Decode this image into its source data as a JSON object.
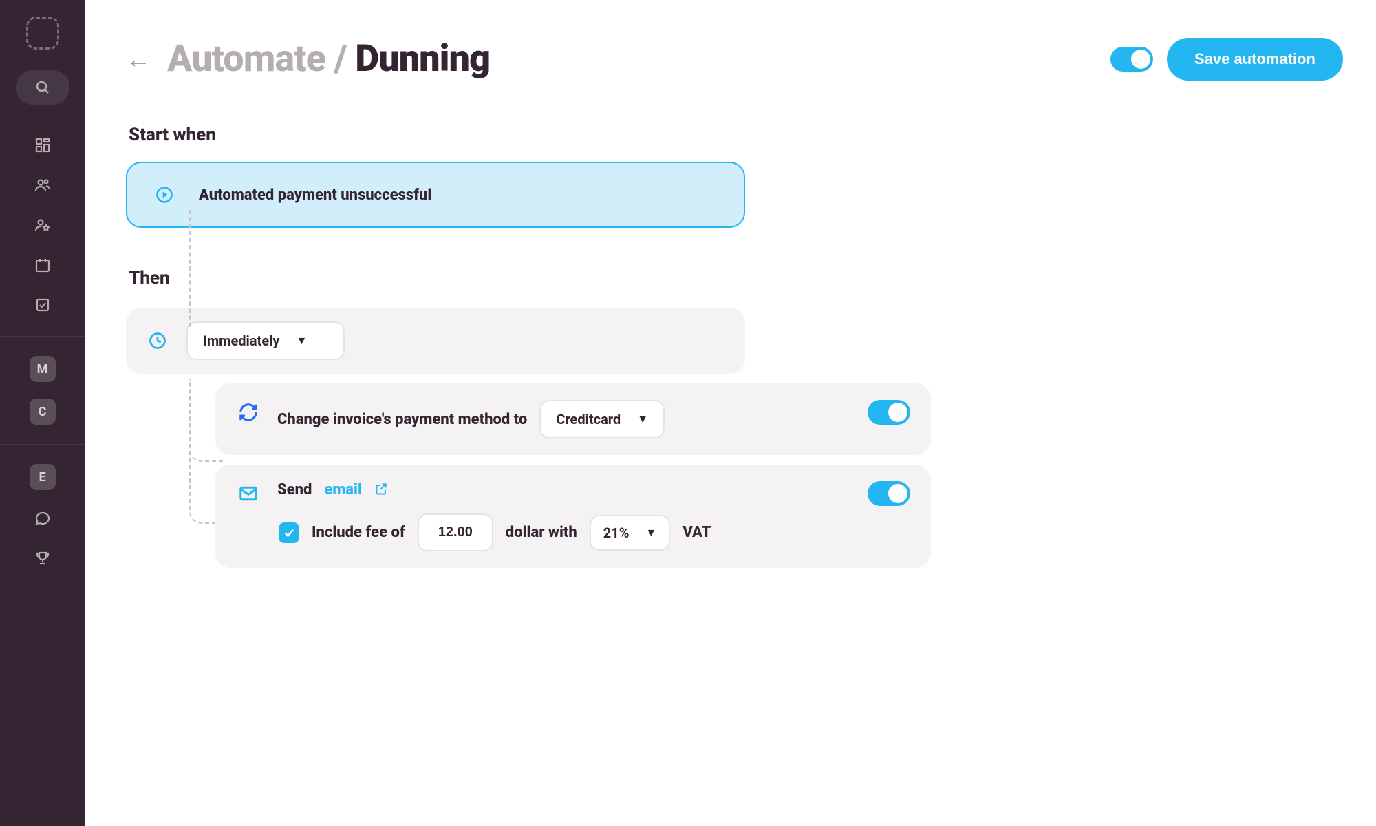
{
  "header": {
    "breadcrumb": "Automate",
    "separator": "/",
    "current": "Dunning",
    "save_label": "Save automation"
  },
  "sidebar": {
    "badges": [
      "M",
      "C",
      "E"
    ]
  },
  "sections": {
    "start_label": "Start when",
    "then_label": "Then"
  },
  "trigger": {
    "label": "Automated payment unsuccessful"
  },
  "timing": {
    "value": "Immediately"
  },
  "action1": {
    "prefix": "Change invoice's payment method to",
    "method": "Creditcard",
    "enabled": true
  },
  "action2": {
    "send_prefix": "Send",
    "send_link": "email",
    "fee_prefix": "Include fee of",
    "fee_amount": "12.00",
    "fee_currency_label": "dollar with",
    "fee_vat": "21%",
    "fee_suffix": "VAT",
    "enabled": true,
    "include_fee_checked": true
  }
}
